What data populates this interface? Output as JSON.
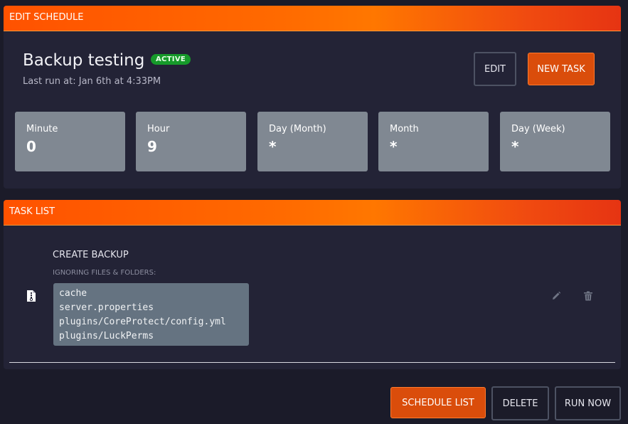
{
  "schedule_panel": {
    "header": "EDIT SCHEDULE",
    "title": "Backup testing",
    "status_badge": "ACTIVE",
    "last_run": "Last run at: Jan 6th at 4:33PM",
    "edit_label": "EDIT",
    "new_task_label": "NEW TASK",
    "cron": [
      {
        "label": "Minute",
        "value": "0"
      },
      {
        "label": "Hour",
        "value": "9"
      },
      {
        "label": "Day (Month)",
        "value": "*"
      },
      {
        "label": "Month",
        "value": "*"
      },
      {
        "label": "Day (Week)",
        "value": "*"
      }
    ]
  },
  "task_panel": {
    "header": "TASK LIST",
    "tasks": [
      {
        "icon": "file-archive-icon",
        "title": "CREATE BACKUP",
        "subtitle": "IGNORING FILES & FOLDERS:",
        "ignored": [
          "cache",
          "server.properties",
          "plugins/CoreProtect/config.yml",
          "plugins/LuckPerms"
        ],
        "actions": [
          "pencil-icon",
          "trash-icon"
        ]
      }
    ]
  },
  "footer": {
    "schedule_list_label": "SCHEDULE LIST",
    "delete_label": "DELETE",
    "run_now_label": "RUN NOW"
  },
  "colors": {
    "accent": "#ff6a00",
    "accent_button": "#da4d0b",
    "active_badge": "#169a2a",
    "panel_bg": "#232336",
    "page_bg": "#1b1b29"
  }
}
